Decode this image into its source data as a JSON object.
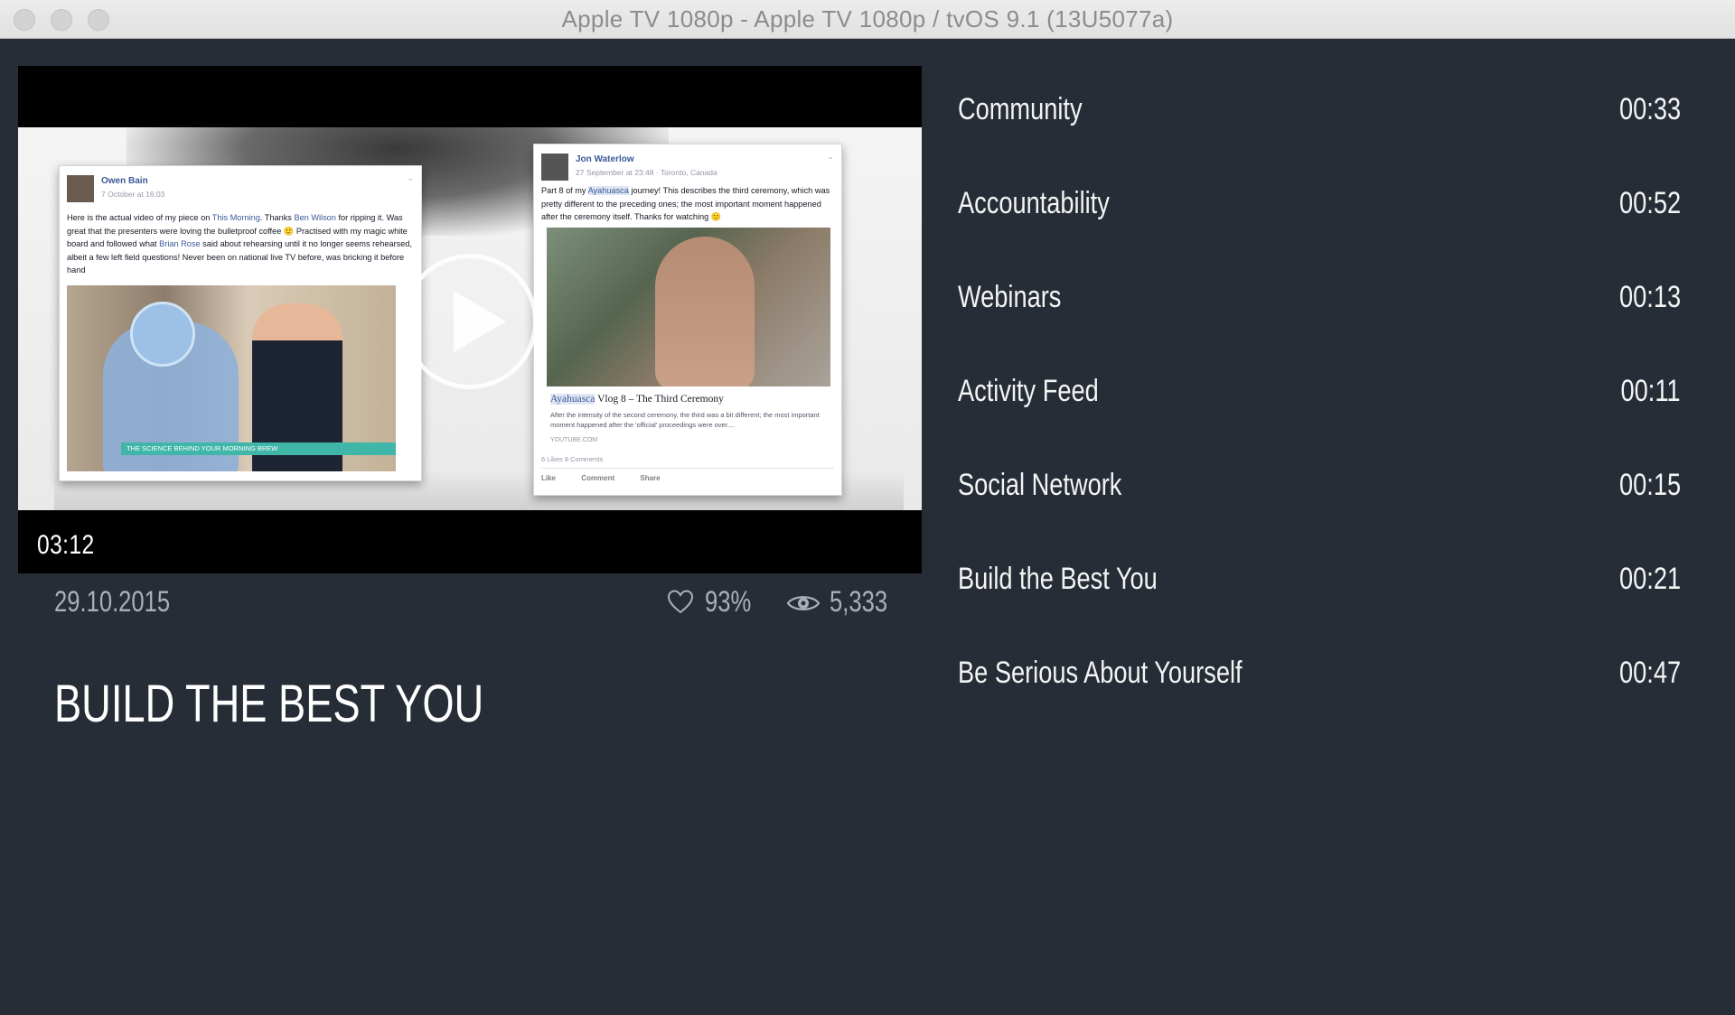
{
  "window": {
    "title": "Apple TV 1080p - Apple TV 1080p / tvOS 9.1 (13U5077a)"
  },
  "player": {
    "duration": "03:12",
    "thumbnail": {
      "left_post": {
        "author": "Owen Bain",
        "date": "7 October at 16:03",
        "text_a": "Here is the actual video of my piece on ",
        "link1": "This Morning",
        "text_b": ". Thanks ",
        "link2": "Ben Wilson",
        "text_c": " for ripping it. Was great that the presenters were loving the bulletproof coffee 🙂 Practised with my magic white board and followed what ",
        "link3": "Brian Rose",
        "text_d": " said about rehearsing until it no longer seems rehearsed, albeit a few left field questions! Never been on national live TV before, was bricking it before hand",
        "caption": "THE SCIENCE BEHIND YOUR MORNING BREW"
      },
      "right_post": {
        "author": "Jon Waterlow",
        "date": "27 September at 23:48 · Toronto, Canada",
        "text_a": "Part 8 of my ",
        "mark": "Ayahuasca",
        "text_b": " journey! This describes the third ceremony, which was pretty different to the preceding ones; the most important moment happened after the ceremony itself. Thanks for watching 🙂",
        "link_title_mark": "Ayahuasca",
        "link_title_rest": " Vlog 8 – The Third Ceremony",
        "link_desc": "After the intensity of the second ceremony, the third was a bit different; the most important moment happened after the 'official' proceedings were over....",
        "link_src": "YOUTUBE.COM",
        "stats": "6 Likes  8 Comments",
        "actions": [
          "Like",
          "Comment",
          "Share"
        ]
      }
    }
  },
  "meta": {
    "date": "29.10.2015",
    "likes": "93%",
    "views": "5,333"
  },
  "video_title": "BUILD THE BEST YOU",
  "playlist": [
    {
      "title": "Community",
      "time": "00:33"
    },
    {
      "title": "Accountability",
      "time": "00:52"
    },
    {
      "title": "Webinars",
      "time": "00:13"
    },
    {
      "title": "Activity Feed",
      "time": "00:11"
    },
    {
      "title": "Social Network",
      "time": "00:15"
    },
    {
      "title": "Build the Best You",
      "time": "00:21"
    },
    {
      "title": "Be Serious About Yourself",
      "time": "00:47"
    }
  ],
  "colors": {
    "background": "#262d37",
    "muted_text": "#a9b0ba",
    "text": "#f4f4f4"
  }
}
